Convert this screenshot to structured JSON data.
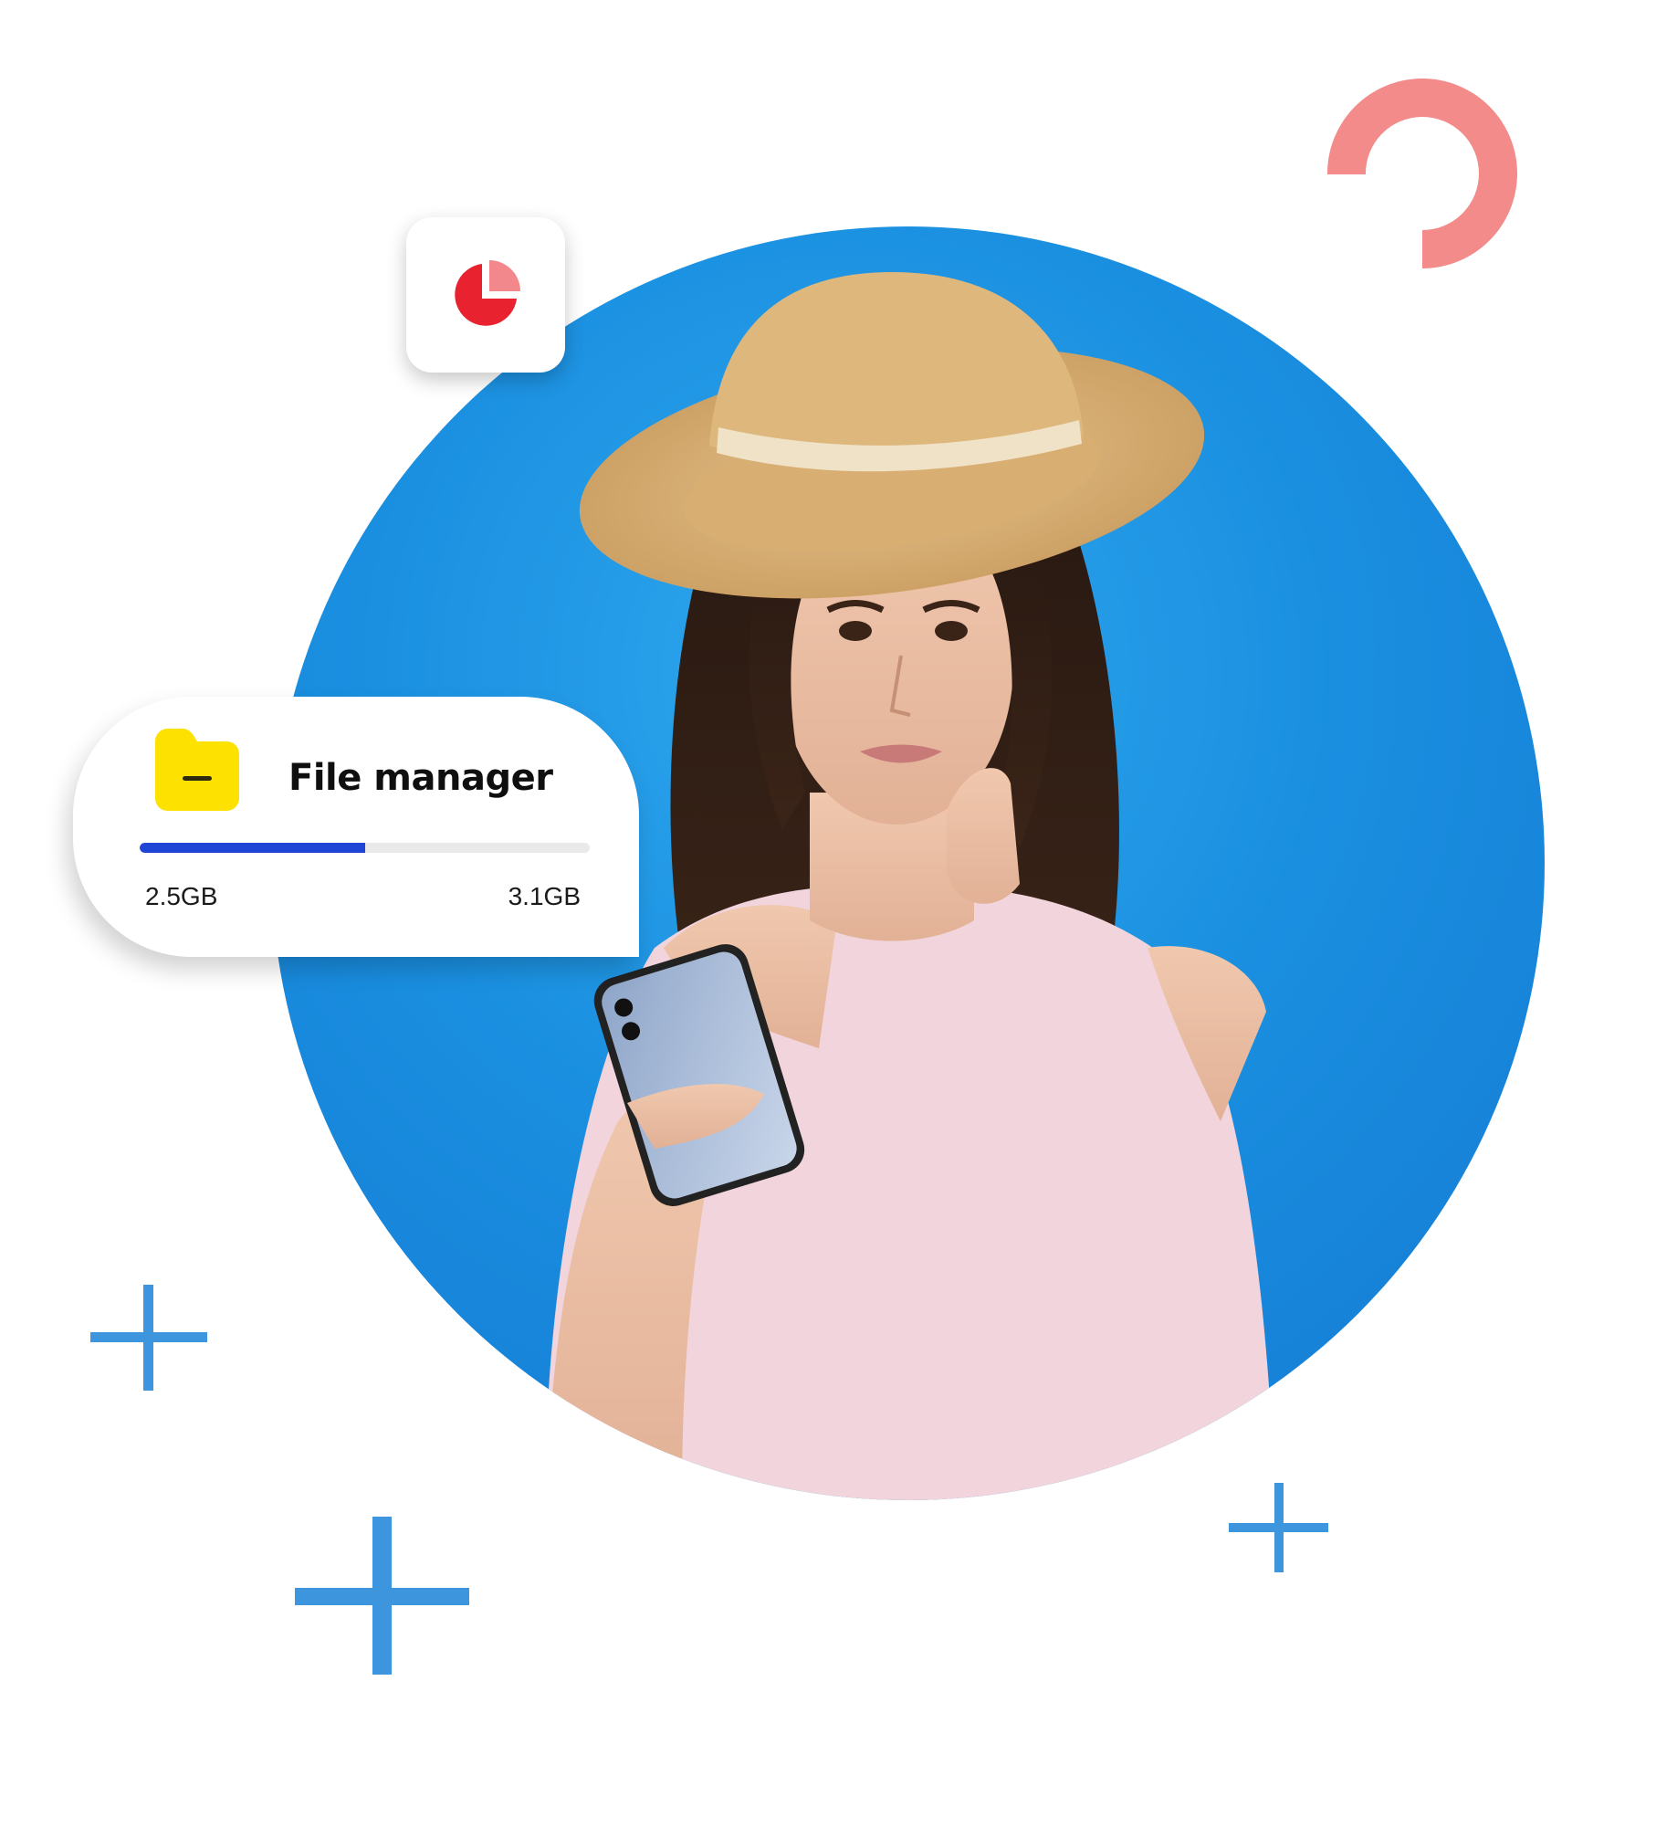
{
  "file_manager": {
    "title": "File manager",
    "used": "2.5GB",
    "total": "3.1GB",
    "usage_fraction": 0.5,
    "folder_icon": "folder-icon",
    "bar_color": "#1f45d6"
  },
  "pie_widget": {
    "icon": "pie-chart-icon",
    "primary_color": "#e8222e",
    "secondary_color": "#f2888c"
  },
  "decorations": {
    "ring_color": "#f28b8a",
    "plus_color": "#3d95dd"
  },
  "hero": {
    "background_color": "#1a8fe0"
  }
}
